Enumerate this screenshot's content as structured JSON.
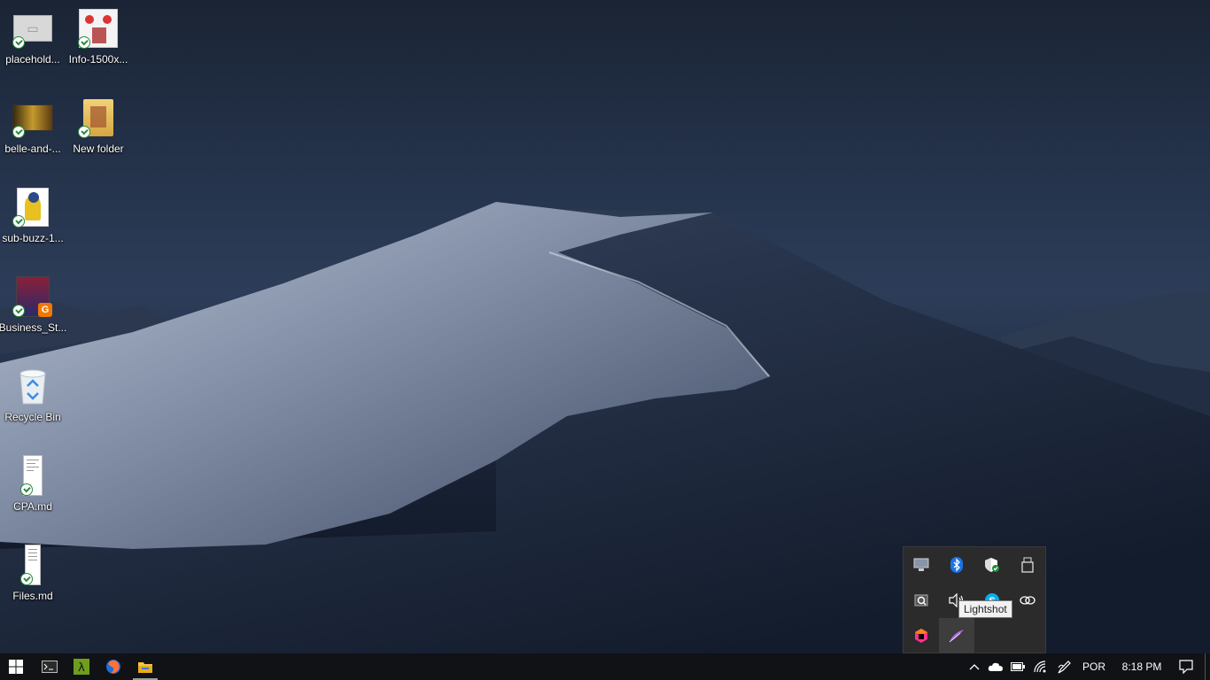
{
  "desktop": {
    "icons": [
      {
        "label": "placehold...",
        "type": "image-file-icon"
      },
      {
        "label": "Info-1500x...",
        "type": "image-file-icon"
      },
      {
        "label": "belle-and-...",
        "type": "image-file-icon"
      },
      {
        "label": "New folder",
        "type": "folder-icon"
      },
      {
        "label": "sub-buzz-1...",
        "type": "image-file-icon"
      },
      {
        "label": "Business_St...",
        "type": "document-icon"
      },
      {
        "label": "Recycle Bin",
        "type": "recycle-bin-icon"
      },
      {
        "label": "CPA.md",
        "type": "text-file-icon"
      },
      {
        "label": "Files.md",
        "type": "text-file-icon"
      }
    ]
  },
  "tray_popup": {
    "icons": [
      "monitor-icon",
      "bluetooth-icon",
      "security-shield-icon",
      "usb-drive-icon",
      "magnifier-icon",
      "volume-icon",
      "skype-icon",
      "link-icon",
      "jetbrains-toolbox-icon",
      "lightshot-feather-icon"
    ],
    "tooltip": "Lightshot"
  },
  "taskbar": {
    "apps": [
      "start-icon",
      "terminal-icon",
      "lambda-icon",
      "firefox-icon",
      "file-explorer-icon"
    ],
    "language": "POR",
    "time": "8:18 PM"
  }
}
